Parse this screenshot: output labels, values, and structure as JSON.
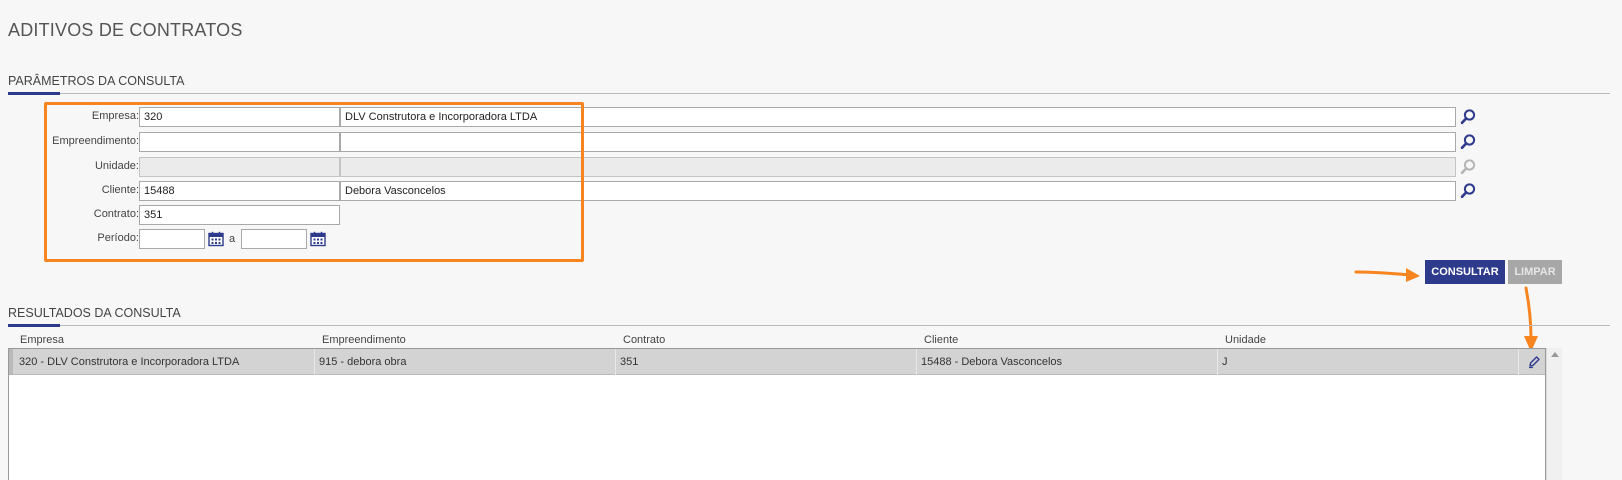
{
  "page": {
    "title": "ADITIVOS DE CONTRATOS"
  },
  "params": {
    "section_title": "PARÂMETROS DA CONSULTA",
    "empresa": {
      "label": "Empresa:",
      "code": "320",
      "name": "DLV Construtora e Incorporadora LTDA"
    },
    "empreendimento": {
      "label": "Empreendimento:",
      "code": "",
      "name": ""
    },
    "unidade": {
      "label": "Unidade:",
      "code": "",
      "name": ""
    },
    "cliente": {
      "label": "Cliente:",
      "code": "15488",
      "name": "Debora Vasconcelos"
    },
    "contrato": {
      "label": "Contrato:",
      "value": "351"
    },
    "periodo": {
      "label": "Período:",
      "from": "",
      "to": "",
      "separator": "a"
    }
  },
  "actions": {
    "consultar_label": "CONSULTAR",
    "limpar_label": "LIMPAR"
  },
  "results": {
    "section_title": "RESULTADOS DA CONSULTA",
    "columns": [
      "Empresa",
      "Empreendimento",
      "Contrato",
      "Cliente",
      "Unidade"
    ],
    "rows": [
      [
        "320 - DLV Construtora e Incorporadora LTDA",
        "915 - debora obra",
        "351",
        "15488 - Debora Vasconcelos",
        "J"
      ]
    ]
  },
  "colors": {
    "primary": "#2e3a8c",
    "highlight": "#f7841e",
    "disabled_button": "#a7a7a7"
  },
  "icons": {
    "search": "magnifier-icon",
    "calendar": "calendar-icon",
    "edit": "pencil-icon"
  }
}
